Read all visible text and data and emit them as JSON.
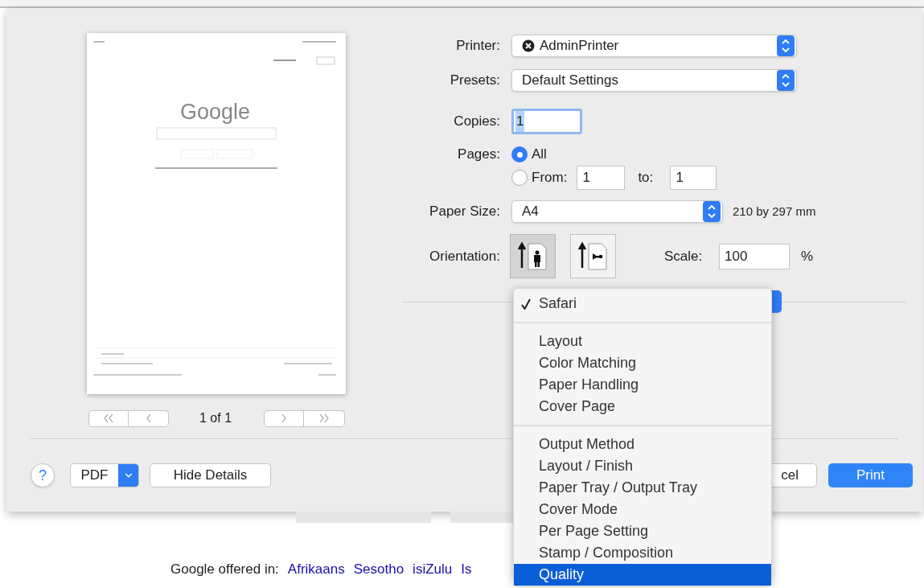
{
  "preview": {
    "logo": "Google",
    "page_indicator": "1 of 1"
  },
  "form": {
    "printer": {
      "label": "Printer:",
      "value": "AdminPrinter"
    },
    "presets": {
      "label": "Presets:",
      "value": "Default Settings"
    },
    "copies": {
      "label": "Copies:",
      "value": "1",
      "text_selected": true
    },
    "pages": {
      "label": "Pages:",
      "options": [
        {
          "label": "All",
          "selected": true
        },
        {
          "label": "From:",
          "selected": false
        }
      ],
      "from": "1",
      "to_label": "to:",
      "to": "1"
    },
    "paper_size": {
      "label": "Paper Size:",
      "value": "A4",
      "dimensions": "210 by 297 mm"
    },
    "orientation": {
      "label": "Orientation:",
      "options": [
        {
          "kind": "portrait",
          "selected": true
        },
        {
          "kind": "landscape",
          "selected": false
        }
      ]
    },
    "scale": {
      "label": "Scale:",
      "value": "100",
      "unit": "%"
    }
  },
  "menu": {
    "sections": [
      [
        {
          "label": "Safari",
          "checked": true,
          "selected": false
        }
      ],
      [
        {
          "label": "Layout",
          "checked": false,
          "selected": false
        },
        {
          "label": "Color Matching",
          "checked": false,
          "selected": false
        },
        {
          "label": "Paper Handling",
          "checked": false,
          "selected": false
        },
        {
          "label": "Cover Page",
          "checked": false,
          "selected": false
        }
      ],
      [
        {
          "label": "Output Method",
          "checked": false,
          "selected": false
        },
        {
          "label": "Layout / Finish",
          "checked": false,
          "selected": false
        },
        {
          "label": "Paper Tray / Output Tray",
          "checked": false,
          "selected": false
        },
        {
          "label": "Cover Mode",
          "checked": false,
          "selected": false
        },
        {
          "label": "Per Page Setting",
          "checked": false,
          "selected": false
        },
        {
          "label": "Stamp / Composition",
          "checked": false,
          "selected": false
        },
        {
          "label": "Quality",
          "checked": false,
          "selected": true
        }
      ]
    ]
  },
  "footer": {
    "help": "?",
    "pdf": "PDF",
    "hide_details": "Hide Details",
    "cancel": "cel",
    "print": "Print"
  },
  "page_below": {
    "prefix": "Google offered in:",
    "languages": [
      "Afrikaans",
      "Sesotho",
      "isiZulu",
      "Is"
    ]
  }
}
